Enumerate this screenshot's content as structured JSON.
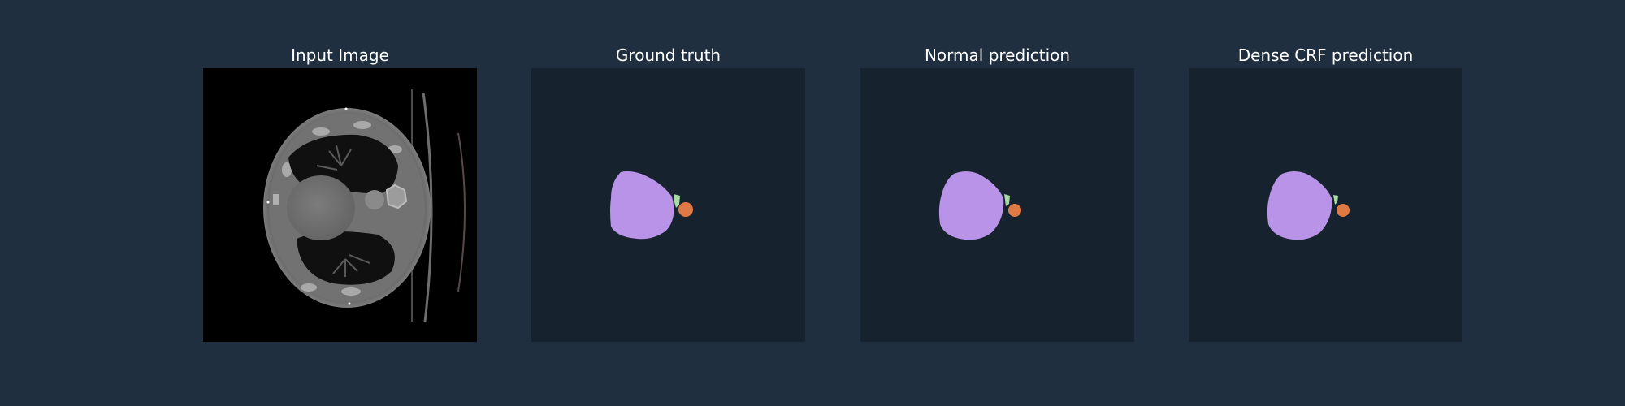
{
  "panels": [
    {
      "title": "Input Image"
    },
    {
      "title": "Ground truth"
    },
    {
      "title": "Normal prediction"
    },
    {
      "title": "Dense CRF prediction"
    }
  ],
  "colors": {
    "figure_background": "#1f2f3f",
    "mask_background": "#16222d",
    "class_purple": "#b993e8",
    "class_green": "#a8d8a4",
    "class_orange": "#e07a45",
    "ct_background": "#000000"
  }
}
